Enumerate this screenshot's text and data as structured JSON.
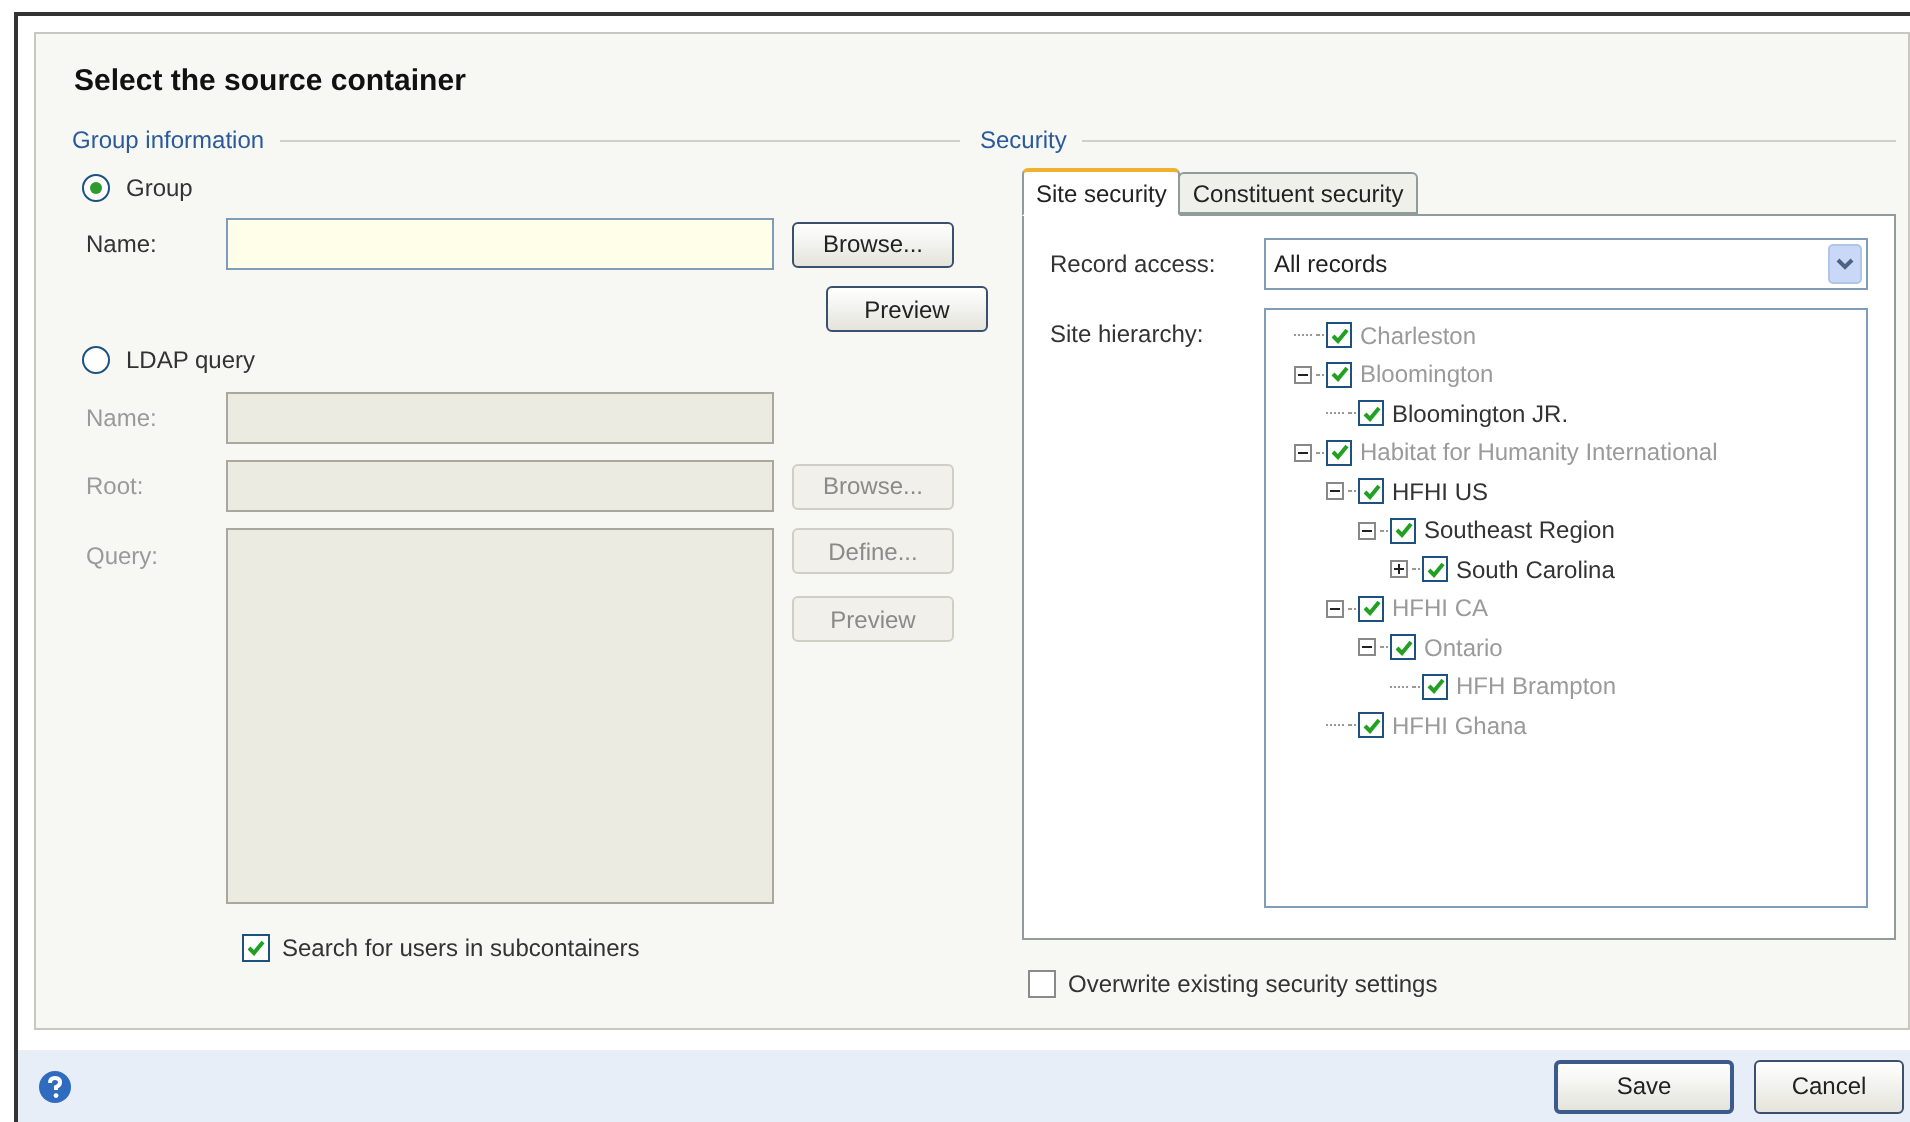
{
  "dialog": {
    "title": "Select the source container"
  },
  "group_information": {
    "legend": "Group information",
    "options": [
      {
        "label": "Group",
        "selected": true
      },
      {
        "label": "LDAP query",
        "selected": false
      }
    ],
    "group": {
      "name_label": "Name:",
      "browse": "Browse...",
      "preview": "Preview"
    },
    "ldap": {
      "disabled": true,
      "name_label": "Name:",
      "root_label": "Root:",
      "query_label": "Query:",
      "browse": "Browse...",
      "define": "Define...",
      "preview": "Preview"
    },
    "subcontainers": {
      "label": "Search for users in subcontainers",
      "checked": true
    }
  },
  "security": {
    "legend": "Security",
    "tabs": [
      {
        "label": "Site security",
        "selected": true
      },
      {
        "label": "Constituent security",
        "selected": false
      }
    ],
    "record_access": {
      "label": "Record access:",
      "value": "All records"
    },
    "site_hierarchy": {
      "label": "Site hierarchy:",
      "tree": [
        {
          "label": "Charleston",
          "checked": true,
          "disabled": true
        },
        {
          "label": "Bloomington",
          "checked": true,
          "disabled": true,
          "expanded": true,
          "children": [
            {
              "label": "Bloomington JR.",
              "checked": true,
              "disabled": false
            }
          ]
        },
        {
          "label": "Habitat for Humanity International",
          "checked": true,
          "disabled": true,
          "expanded": true,
          "children": [
            {
              "label": "HFHI US",
              "checked": true,
              "disabled": false,
              "expanded": true,
              "children": [
                {
                  "label": "Southeast Region",
                  "checked": true,
                  "disabled": false,
                  "expanded": true,
                  "children": [
                    {
                      "label": "South Carolina",
                      "checked": true,
                      "disabled": false,
                      "expanded": false
                    }
                  ]
                }
              ]
            },
            {
              "label": "HFHI CA",
              "checked": true,
              "disabled": true,
              "expanded": true,
              "children": [
                {
                  "label": "Ontario",
                  "checked": true,
                  "disabled": true,
                  "expanded": true,
                  "children": [
                    {
                      "label": "HFH Brampton",
                      "checked": true,
                      "disabled": true
                    }
                  ]
                }
              ]
            },
            {
              "label": "HFHI Ghana",
              "checked": true,
              "disabled": true
            }
          ]
        }
      ]
    },
    "overwrite": {
      "label": "Overwrite existing security settings",
      "checked": false
    }
  },
  "footer": {
    "buttons": [
      "Save",
      "Cancel"
    ]
  }
}
